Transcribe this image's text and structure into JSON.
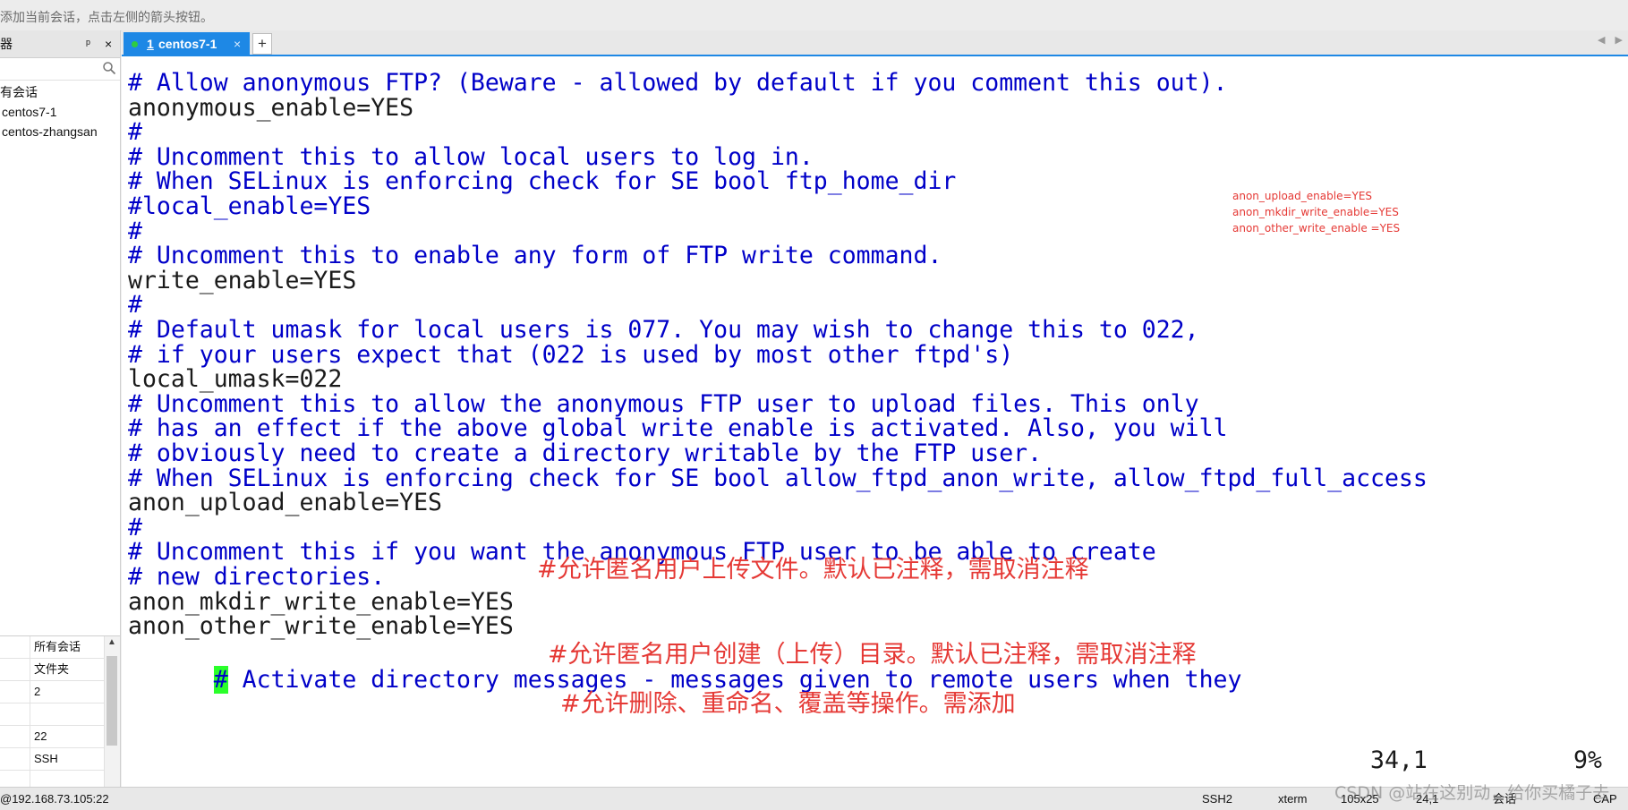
{
  "hint": "添加当前会话，点击左侧的箭头按钮。",
  "sidebar": {
    "title": "器",
    "pin_glyph": "ᵖ",
    "close_glyph": "×",
    "sessions": [
      {
        "label": "有会话"
      },
      {
        "label": "centos7-1"
      },
      {
        "label": "centos-zhangsan"
      }
    ]
  },
  "properties": {
    "rows": [
      {
        "value": "所有会话"
      },
      {
        "value": "文件夹"
      },
      {
        "value": "2"
      },
      {
        "value": ""
      },
      {
        "value": "22"
      },
      {
        "value": "SSH"
      },
      {
        "value": ""
      },
      {
        "value": ""
      }
    ]
  },
  "tabs": {
    "active": {
      "number": "1",
      "label": "centos7-1",
      "close": "×"
    },
    "add_label": "+",
    "nav_left": "◀",
    "nav_right": "▶"
  },
  "terminal": {
    "lines": [
      {
        "text": "# Allow anonymous FTP? (Beware - allowed by default if you comment this out).",
        "comment": true
      },
      {
        "text": "anonymous_enable=YES",
        "comment": false
      },
      {
        "text": "#",
        "comment": true
      },
      {
        "text": "# Uncomment this to allow local users to log in.",
        "comment": true
      },
      {
        "text": "# When SELinux is enforcing check for SE bool ftp_home_dir",
        "comment": true
      },
      {
        "text": "#local_enable=YES",
        "comment": true
      },
      {
        "text": "#",
        "comment": true
      },
      {
        "text": "# Uncomment this to enable any form of FTP write command.",
        "comment": true
      },
      {
        "text": "write_enable=YES",
        "comment": false
      },
      {
        "text": "#",
        "comment": true
      },
      {
        "text": "# Default umask for local users is 077. You may wish to change this to 022,",
        "comment": true
      },
      {
        "text": "# if your users expect that (022 is used by most other ftpd's)",
        "comment": true
      },
      {
        "text": "local_umask=022",
        "comment": false
      },
      {
        "text": "# Uncomment this to allow the anonymous FTP user to upload files. This only",
        "comment": true
      },
      {
        "text": "# has an effect if the above global write enable is activated. Also, you will",
        "comment": true
      },
      {
        "text": "# obviously need to create a directory writable by the FTP user.",
        "comment": true
      },
      {
        "text": "# When SELinux is enforcing check for SE bool allow_ftpd_anon_write, allow_ftpd_full_access",
        "comment": true
      },
      {
        "text": "anon_upload_enable=YES",
        "comment": false
      },
      {
        "text": "#",
        "comment": true
      },
      {
        "text": "# Uncomment this if you want the anonymous FTP user to be able to create",
        "comment": true
      },
      {
        "text": "# new directories.",
        "comment": true
      },
      {
        "text": "anon_mkdir_write_enable=YES",
        "comment": false
      },
      {
        "text": "anon_other_write_enable=YES",
        "comment": false
      }
    ],
    "cursor_line": {
      "hash": "#",
      "rest": " Activate directory messages - messages given to remote users when they"
    },
    "status_position": "34,1",
    "status_percent": "9%"
  },
  "annotations": {
    "small": [
      "anon_upload_enable=YES",
      "anon_mkdir_write_enable=YES",
      "anon_other_write_enable =YES"
    ],
    "upload": "#允许匿名用户上传文件。默认已注释，需取消注释",
    "mkdir": "#允许匿名用户创建（上传）目录。默认已注释，需取消注释",
    "other": "#允许删除、重命名、覆盖等操作。需添加"
  },
  "statusbar": {
    "host": "@192.168.73.105:22",
    "protocol": "SSH2",
    "term": "xterm",
    "size": "105x25",
    "cursor": "24,1",
    "sessions": "会话",
    "caps": "CAP"
  },
  "watermark": "CSDN @站在这别动，给你买橘子去",
  "colors": {
    "accent": "#1e88e5",
    "comment": "#0000c8",
    "annotation": "#e53935",
    "cursor": "#2aff2a"
  }
}
